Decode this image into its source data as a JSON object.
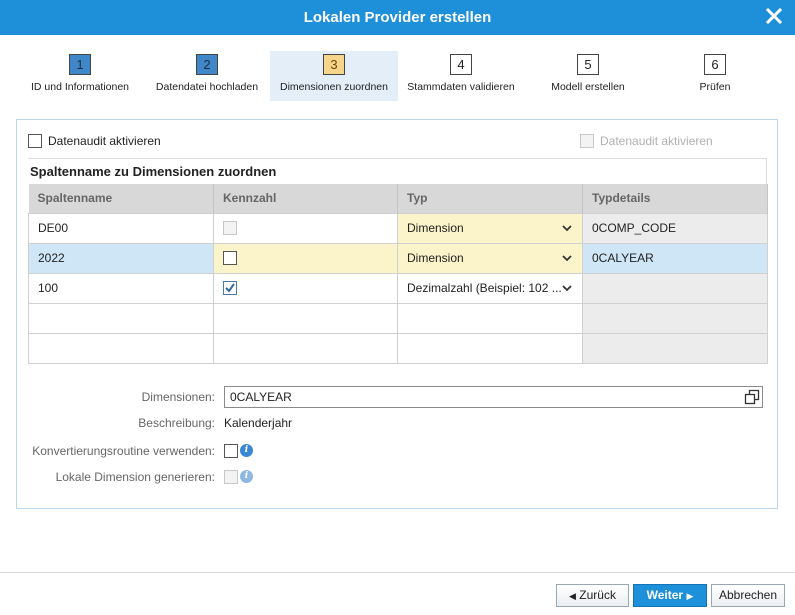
{
  "dialog": {
    "title": "Lokalen Provider erstellen"
  },
  "steps": [
    {
      "num": "1",
      "label": "ID und Informationen",
      "state": "done"
    },
    {
      "num": "2",
      "label": "Datendatei hochladen",
      "state": "done"
    },
    {
      "num": "3",
      "label": "Dimensionen zuordnen",
      "state": "active"
    },
    {
      "num": "4",
      "label": "Stammdaten validieren",
      "state": "todo"
    },
    {
      "num": "5",
      "label": "Modell erstellen",
      "state": "todo"
    },
    {
      "num": "6",
      "label": "Prüfen",
      "state": "todo"
    }
  ],
  "audit": {
    "left_label": "Datenaudit aktivieren",
    "right_label": "Datenaudit aktivieren"
  },
  "mapping": {
    "title": "Spaltenname zu Dimensionen zuordnen",
    "headers": [
      "Spaltenname",
      "Kennzahl",
      "Typ",
      "Typdetails"
    ],
    "rows": [
      {
        "name": "DE00",
        "measure": "disabled",
        "type": "Dimension",
        "details": "0COMP_CODE"
      },
      {
        "name": "2022",
        "measure": "unchecked",
        "type": "Dimension",
        "details": "0CALYEAR"
      },
      {
        "name": "100",
        "measure": "checked",
        "type": "Dezimalzahl (Beispiel: 102 ...",
        "details": ""
      }
    ]
  },
  "form": {
    "dimension_label": "Dimensionen:",
    "dimension_value": "0CALYEAR",
    "description_label": "Beschreibung:",
    "description_value": "Kalenderjahr",
    "conversion_label": "Konvertierungsroutine verwenden:",
    "local_dim_label": "Lokale Dimension generieren:"
  },
  "footer": {
    "back_label": "Zurück",
    "next_label": "Weiter",
    "cancel_label": "Abbrechen"
  },
  "colors": {
    "titlebar": "#1e8fd9",
    "step_done": "#3f87c9",
    "step_active": "#f7d58a",
    "selected_row": "#cfe6f7",
    "editable_cell": "#fbf3c9"
  }
}
